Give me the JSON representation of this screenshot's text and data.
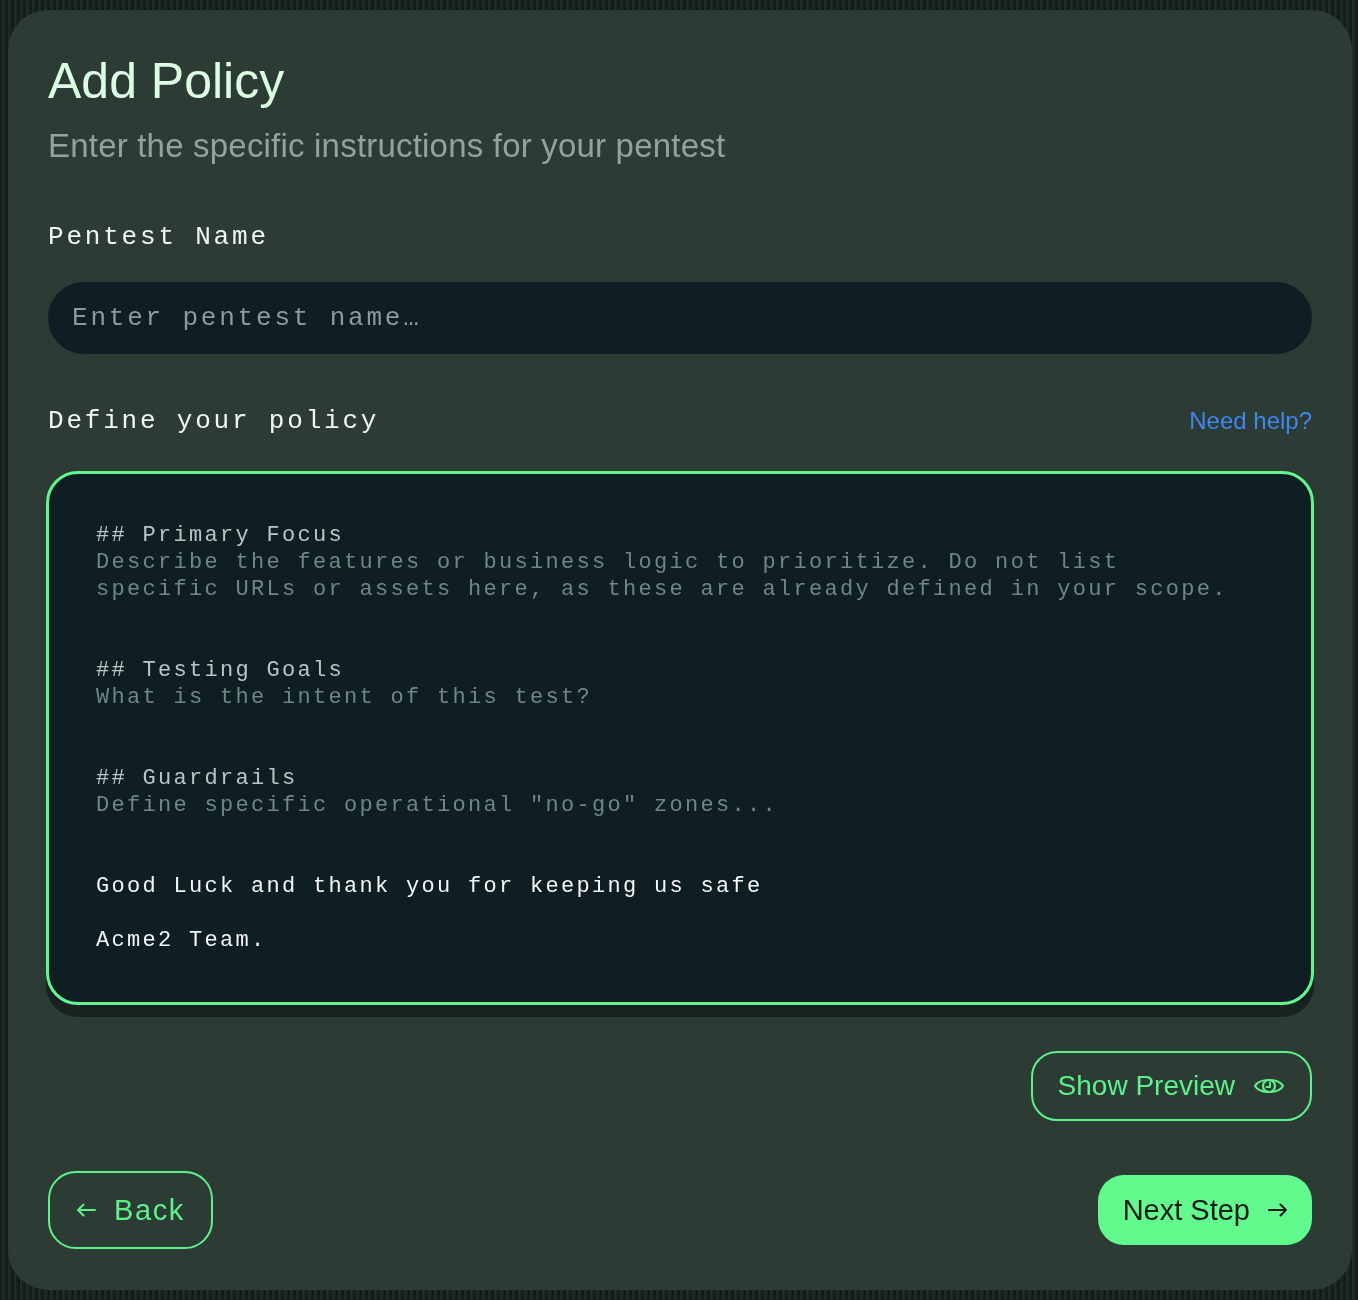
{
  "dialog": {
    "title": "Add Policy",
    "subtitle": "Enter the specific instructions for your pentest"
  },
  "name_field": {
    "label": "Pentest Name",
    "placeholder": "Enter pentest name…"
  },
  "policy": {
    "label": "Define your policy",
    "help_link": "Need help?",
    "editor": {
      "focused": true,
      "sections": [
        {
          "heading": "## Primary Focus",
          "hint": "Describe the features or business logic to prioritize. Do not list specific URLs or assets here, as these are already defined in your scope."
        },
        {
          "heading": "## Testing Goals",
          "hint": "What is the intent of this test?"
        },
        {
          "heading": "## Guardrails",
          "hint": "Define specific operational \"no-go\" zones..."
        }
      ],
      "closing": [
        "Good Luck and thank you for keeping us safe",
        "Acme2 Team."
      ]
    }
  },
  "preview_button": {
    "label": "Show Preview"
  },
  "footer": {
    "back": "Back",
    "next": "Next Step"
  }
}
